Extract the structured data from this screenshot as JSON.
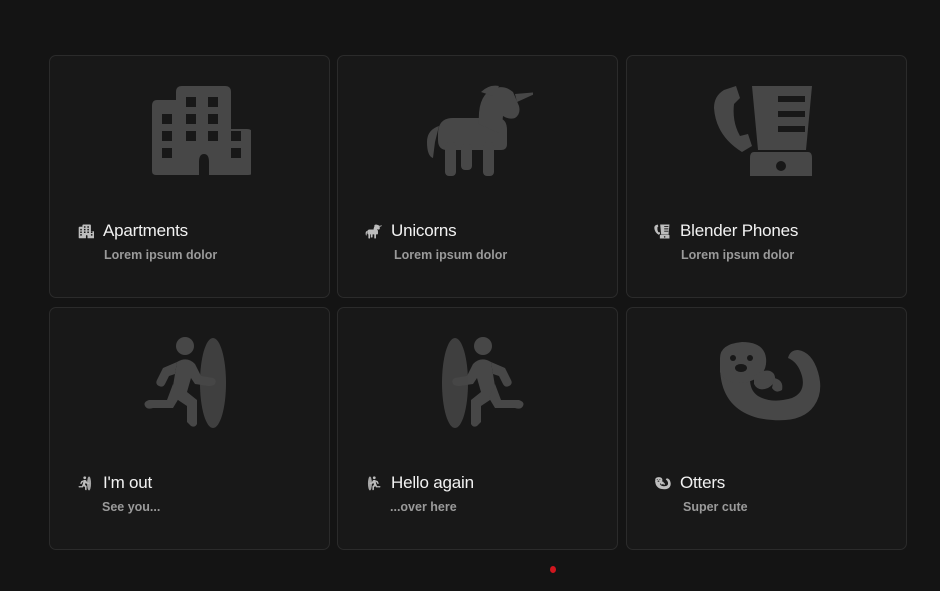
{
  "cards": [
    {
      "title": "Apartments",
      "subtitle": "Lorem ipsum dolor",
      "icon": "apartments-icon"
    },
    {
      "title": "Unicorns",
      "subtitle": "Lorem ipsum dolor",
      "icon": "unicorn-icon"
    },
    {
      "title": "Blender Phones",
      "subtitle": "Lorem ipsum dolor",
      "icon": "blender-phone-icon"
    },
    {
      "title": "I'm out",
      "subtitle": "See you...",
      "icon": "person-running-out-icon"
    },
    {
      "title": "Hello again",
      "subtitle": "...over here",
      "icon": "person-running-in-icon"
    },
    {
      "title": "Otters",
      "subtitle": "Super cute",
      "icon": "otter-icon"
    }
  ],
  "colors": {
    "background": "#141414",
    "card": "#181818",
    "card_border": "#2b2b2b",
    "icon": "#474747",
    "title": "#f2f2f2",
    "subtitle": "#9a9a9a",
    "indicator": "#d0161e"
  }
}
